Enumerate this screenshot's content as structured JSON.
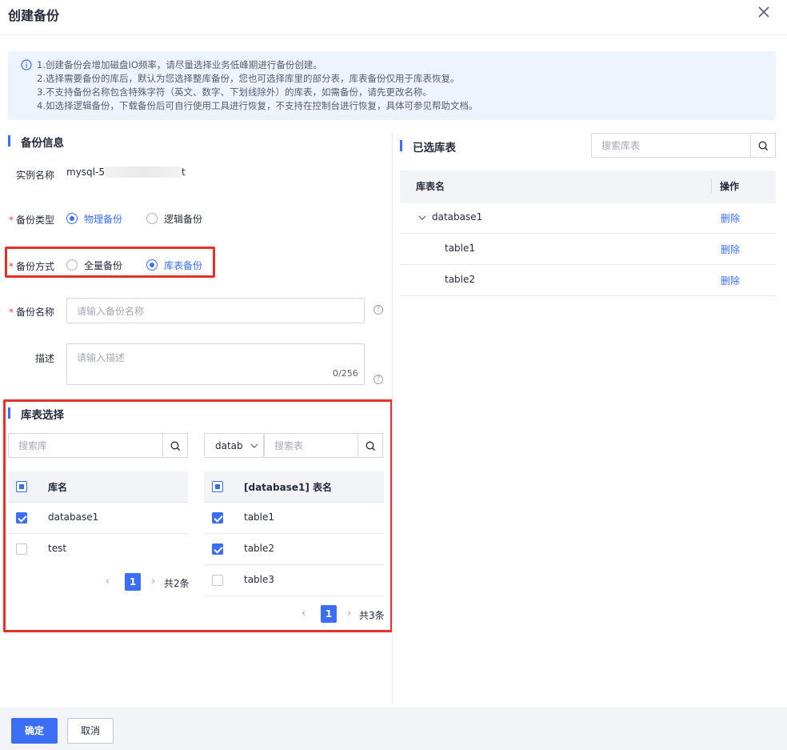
{
  "dialog": {
    "title": "创建备份"
  },
  "notice": {
    "lines": [
      "1.创建备份会增加磁盘IO频率，请尽量选择业务低峰期进行备份创建。",
      "2.选择需要备份的库后，默认为您选择整库备份，您也可选择库里的部分表，库表备份仅用于库表恢复。",
      "3.不支持备份名称包含特殊字符（英文、数字、下划线除外）的库表，如需备份，请先更改名称。",
      "4.如选择逻辑备份，下载备份后可自行使用工具进行恢复，不支持在控制台进行恢复，具体可参见帮助文档。"
    ]
  },
  "backup_info": {
    "section_title": "备份信息",
    "instance_label": "实例名称",
    "instance_prefix": "mysql-5",
    "instance_suffix": "t",
    "type_label": "备份类型",
    "type_options": [
      "物理备份",
      "逻辑备份"
    ],
    "type_selected": "物理备份",
    "method_label": "备份方式",
    "method_options": [
      "全量备份",
      "库表备份"
    ],
    "method_selected": "库表备份",
    "name_label": "备份名称",
    "name_placeholder": "请输入备份名称",
    "desc_label": "描述",
    "desc_placeholder": "请输入描述",
    "desc_counter": "0/256"
  },
  "db_select": {
    "section_title": "库表选择",
    "db_search_placeholder": "搜索库",
    "db_dropdown_value": "datab",
    "table_search_placeholder": "搜索表",
    "db_header": "库名",
    "db_rows": [
      {
        "name": "database1",
        "checked": true
      },
      {
        "name": "test",
        "checked": false
      }
    ],
    "db_page": "1",
    "db_total": "共2条",
    "table_header": "[database1] 表名",
    "table_rows": [
      {
        "name": "table1",
        "checked": true
      },
      {
        "name": "table2",
        "checked": true
      },
      {
        "name": "table3",
        "checked": false
      }
    ],
    "table_page": "1",
    "table_total": "共3条"
  },
  "selected": {
    "section_title": "已选库表",
    "search_placeholder": "搜索库表",
    "col_name": "库表名",
    "col_action": "操作",
    "rows": [
      {
        "name": "database1",
        "action": "删除"
      },
      {
        "name": "table1",
        "action": "删除"
      },
      {
        "name": "table2",
        "action": "删除"
      }
    ]
  },
  "footer": {
    "confirm": "确定",
    "cancel": "取消"
  },
  "colors": {
    "accent": "#3b6ef5",
    "highlight_border": "#e8302a",
    "required": "#e54545"
  }
}
